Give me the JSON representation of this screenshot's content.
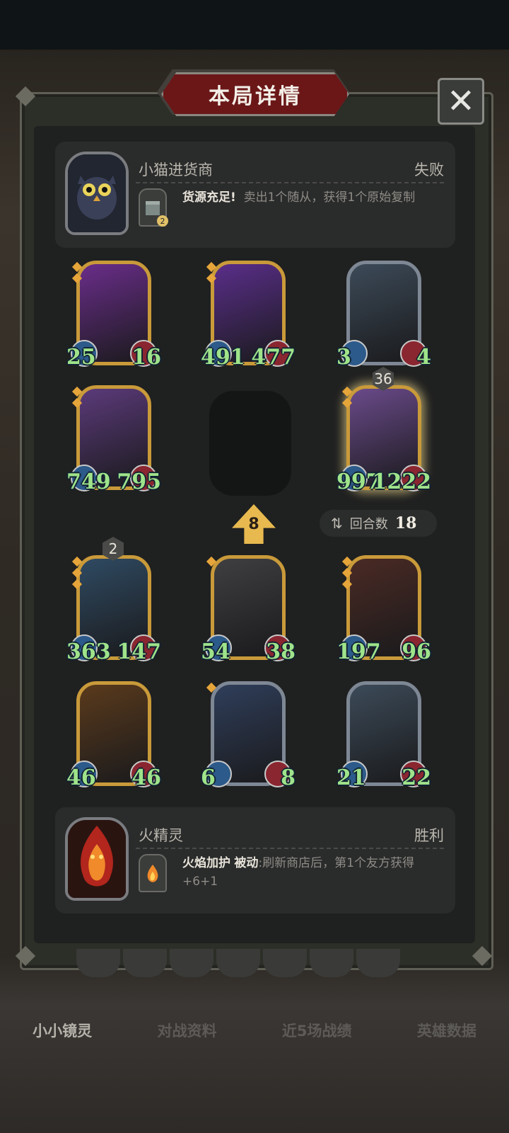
{
  "title": "本局详情",
  "close_label": "✕",
  "opponent": {
    "name": "小猫进货商",
    "result": "失败",
    "skill_name": "货源充足!",
    "skill_desc": "卖出1个随从，获得1个原始复制",
    "skill_badge": "2"
  },
  "player": {
    "name": "火精灵",
    "result": "胜利",
    "skill_name": "火焰加护",
    "skill_type": "被动",
    "skill_desc": ":刷新商店后，第1个友方获得+6+1"
  },
  "board_top": [
    {
      "atk": "25",
      "hp": "16",
      "frame": "gold",
      "stars": 2
    },
    {
      "atk": "491",
      "hp": "477",
      "frame": "gold",
      "stars": 2
    },
    {
      "atk": "3",
      "hp": "4",
      "frame": "silver",
      "stars": 0
    },
    {
      "atk": "749",
      "hp": "795",
      "frame": "gold",
      "stars": 2
    },
    {
      "atk": "997",
      "hp": "1222",
      "frame": "gold",
      "stars": 2,
      "level": "36"
    }
  ],
  "board_bottom": [
    {
      "atk": "363",
      "hp": "147",
      "frame": "gold",
      "stars": 3,
      "level": "2"
    },
    {
      "atk": "54",
      "hp": "38",
      "frame": "gold",
      "stars": 1
    },
    {
      "atk": "197",
      "hp": "96",
      "frame": "gold",
      "stars": 3
    },
    {
      "atk": "46",
      "hp": "46",
      "frame": "gold",
      "stars": 0
    },
    {
      "atk": "6",
      "hp": "8",
      "frame": "silver",
      "stars": 1
    },
    {
      "atk": "21",
      "hp": "22",
      "frame": "silver",
      "stars": 0
    }
  ],
  "tavern_tier": "8",
  "rounds": {
    "label": "回合数",
    "value": "18"
  },
  "tabs": [
    "小小镜灵",
    "对战资料",
    "近5场战绩",
    "英雄数据"
  ],
  "colors": {
    "stat_green": "#9fe38a",
    "gold_frame": "#c99a3a",
    "banner_red": "#6b1718"
  }
}
